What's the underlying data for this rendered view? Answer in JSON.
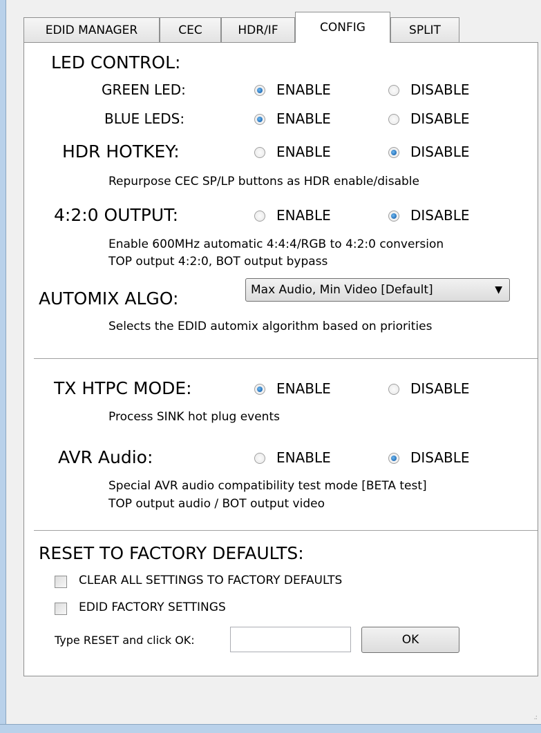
{
  "tabs": [
    "EDID MANAGER",
    "CEC",
    "HDR/IF",
    "CONFIG",
    "SPLIT"
  ],
  "active_tab": "CONFIG",
  "enable_label": "ENABLE",
  "disable_label": "DISABLE",
  "led_control": {
    "title": "LED CONTROL:",
    "green": {
      "label": "GREEN LED:",
      "selected": "ENABLE"
    },
    "blue": {
      "label": "BLUE LEDS:",
      "selected": "ENABLE"
    }
  },
  "hdr_hotkey": {
    "title": "HDR HOTKEY:",
    "selected": "DISABLE",
    "desc": "Repurpose CEC SP/LP buttons as HDR enable/disable"
  },
  "output_420": {
    "title": "4:2:0 OUTPUT:",
    "selected": "DISABLE",
    "desc1": "Enable 600MHz automatic 4:4:4/RGB to 4:2:0 conversion",
    "desc2": "TOP output 4:2:0, BOT output bypass"
  },
  "automix": {
    "title": "AUTOMIX ALGO:",
    "selected": "Max Audio, Min Video [Default]",
    "desc": "Selects the EDID automix algorithm based on priorities"
  },
  "tx_htpc": {
    "title": "TX HTPC MODE:",
    "selected": "ENABLE",
    "desc": "Process SINK hot plug events"
  },
  "avr_audio": {
    "title": "AVR Audio:",
    "selected": "DISABLE",
    "desc1": "Special AVR audio compatibility test mode [BETA test]",
    "desc2": "TOP output audio / BOT output video"
  },
  "reset": {
    "title": "RESET TO FACTORY DEFAULTS:",
    "clear_all": "CLEAR ALL SETTINGS TO FACTORY DEFAULTS",
    "edid_factory": "EDID FACTORY SETTINGS",
    "type_prompt": "Type RESET and click OK:",
    "input_value": "",
    "ok_label": "OK"
  }
}
